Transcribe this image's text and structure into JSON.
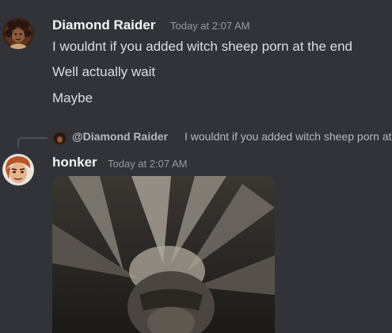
{
  "messages": [
    {
      "author": "Diamond Raider",
      "timestamp": "Today at 2:07 AM",
      "lines": [
        "I wouldnt if you added witch sheep porn at the end",
        "Well actually wait",
        "Maybe"
      ],
      "author_color": "#f2f3f5"
    },
    {
      "author": "honker",
      "timestamp": "Today at 2:07 AM",
      "reply": {
        "author": "@Diamond Raider",
        "text": "I wouldnt if you added witch sheep porn at the end"
      },
      "attachment": "image"
    }
  ],
  "colors": {
    "background": "#313338",
    "text": "#dbdee1",
    "muted": "#949ba4"
  }
}
